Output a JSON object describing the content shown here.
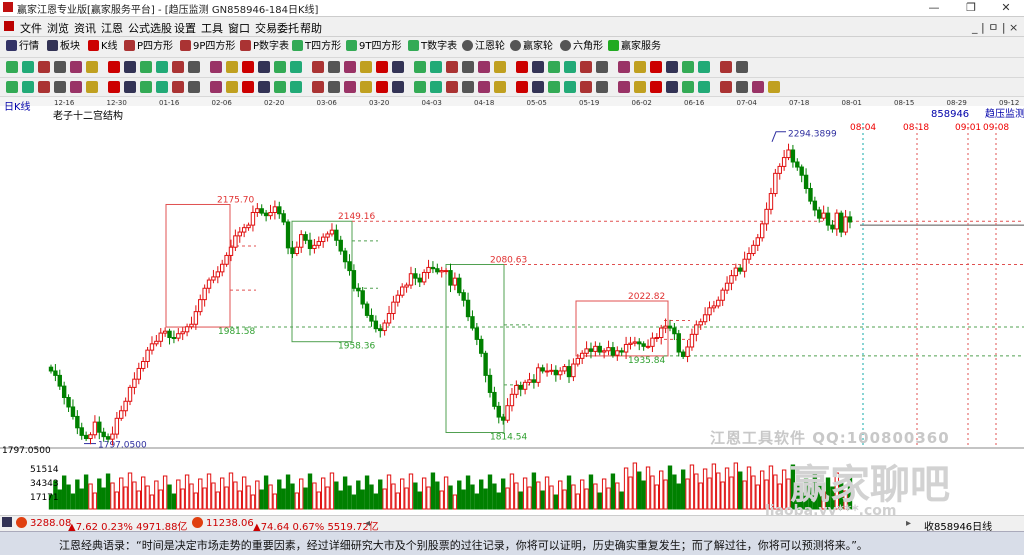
{
  "window": {
    "title": "赢家江恩专业版[赢家服务平台] - [趋压监测  GN858946-184日K线]",
    "buttons": {
      "min": "—",
      "max": "❐",
      "close": "✕"
    }
  },
  "menu": {
    "items": [
      "文件",
      "浏览",
      "资讯",
      "江恩",
      "公式选股",
      "设置",
      "工具",
      "窗口",
      "交易委托",
      "帮助"
    ],
    "right": "_ | ㅁ | ×"
  },
  "toolbar": {
    "items": [
      {
        "label": "行情",
        "icon": "grid-icon",
        "color": "#336"
      },
      {
        "label": "板块",
        "icon": "blocks-icon",
        "color": "#335"
      },
      {
        "label": "K线",
        "icon": "kline-icon",
        "color": "#c00"
      },
      {
        "label": "P四方形",
        "icon": "p-square-icon",
        "color": "#a33"
      },
      {
        "label": "9P四方形",
        "icon": "9p-square-icon",
        "color": "#a33"
      },
      {
        "label": "P数字表",
        "icon": "p-table-icon",
        "color": "#a33"
      },
      {
        "label": "T四方形",
        "icon": "t-square-icon",
        "color": "#3a5"
      },
      {
        "label": "9T四方形",
        "icon": "9t-square-icon",
        "color": "#3a5"
      },
      {
        "label": "T数字表",
        "icon": "t-table-icon",
        "color": "#3a5"
      },
      {
        "label": "江恩轮",
        "icon": "gann-wheel-icon",
        "color": "#555"
      },
      {
        "label": "赢家轮",
        "icon": "winner-wheel-icon",
        "color": "#555"
      },
      {
        "label": "六角形",
        "icon": "hexagon-icon",
        "color": "#555"
      },
      {
        "label": "赢家服务",
        "icon": "dollar-icon",
        "color": "#2a2"
      }
    ]
  },
  "chart_header": {
    "period": "日K线",
    "dates": [
      "12-16",
      "12-30",
      "01-16",
      "02-06",
      "02-20",
      "03-06",
      "03-20",
      "04-03",
      "04-18",
      "05-05",
      "05-19",
      "06-02",
      "06-16",
      "07-04",
      "07-18",
      "08-01",
      "08-15",
      "08-29",
      "09-12"
    ],
    "right_code": "858946",
    "right_label": "趋压监测",
    "study": "老子十二宫结构"
  },
  "chart_data": {
    "type": "candlestick",
    "price_labels": [
      {
        "text": "2294.3899",
        "value": 2294.39
      },
      {
        "text": "2175.70",
        "value": 2175.7
      },
      {
        "text": "2149.16",
        "value": 2149.16
      },
      {
        "text": "2080.63",
        "value": 2080.63
      },
      {
        "text": "2022.82",
        "value": 2022.82
      },
      {
        "text": "1981.58",
        "value": 1981.58
      },
      {
        "text": "1958.36",
        "value": 1958.36
      },
      {
        "text": "1935.84",
        "value": 1935.84
      },
      {
        "text": "1814.54",
        "value": 1814.54
      },
      {
        "text": "1797.0500",
        "value": 1797.05
      }
    ],
    "axis_price_label": "1797.0500",
    "future_dates": [
      "08-04",
      "08-18",
      "09-01",
      "09-08"
    ],
    "volume_axis": [
      "51514",
      "34343",
      "17171"
    ],
    "closes": [
      1912,
      1905,
      1888,
      1870,
      1855,
      1840,
      1822,
      1810,
      1805,
      1811,
      1831,
      1815,
      1808,
      1804,
      1812,
      1837,
      1849,
      1864,
      1886,
      1899,
      1916,
      1927,
      1945,
      1955,
      1959,
      1972,
      1975,
      1965,
      1964,
      1971,
      1974,
      1982,
      1986,
      2006,
      2025,
      2043,
      2056,
      2061,
      2069,
      2081,
      2095,
      2108,
      2126,
      2132,
      2139,
      2143,
      2163,
      2169,
      2162,
      2158,
      2163,
      2172,
      2161,
      2148,
      2107,
      2098,
      2108,
      2128,
      2119,
      2106,
      2111,
      2117,
      2124,
      2129,
      2135,
      2119,
      2102,
      2085,
      2071,
      2043,
      2039,
      2018,
      2000,
      1991,
      1979,
      1976,
      1988,
      2003,
      2021,
      2032,
      2045,
      2048,
      2066,
      2059,
      2053,
      2068,
      2076,
      2074,
      2069,
      2071,
      2071,
      2048,
      2059,
      2036,
      2024,
      1998,
      1980,
      1962,
      1940,
      1905,
      1878,
      1856,
      1839,
      1834,
      1857,
      1875,
      1889,
      1883,
      1894,
      1898,
      1894,
      1917,
      1912,
      1912,
      1913,
      1906,
      1912,
      1919,
      1903,
      1923,
      1932,
      1940,
      1947,
      1943,
      1951,
      1942,
      1944,
      1949,
      1937,
      1944,
      1942,
      1954,
      1956,
      1958,
      1955,
      1951,
      1951,
      1964,
      1965,
      1980,
      1983,
      1980,
      1971,
      1942,
      1935,
      1950,
      1970,
      1985,
      1990,
      2001,
      2012,
      2015,
      2024,
      2040,
      2051,
      2063,
      2075,
      2070,
      2089,
      2098,
      2111,
      2123,
      2145,
      2168,
      2193,
      2225,
      2236,
      2250,
      2262,
      2243,
      2235,
      2222,
      2201,
      2181,
      2167,
      2154,
      2162,
      2143,
      2137,
      2162,
      2132,
      2156,
      2148
    ]
  },
  "status": {
    "idx1": "3288.08",
    "idx1_change": "▲7.62 0.23% 4971.88亿",
    "idx2": "11238.06",
    "idx2_change": "▲74.64 0.67% 5519.72亿",
    "right": "收858946日线"
  },
  "watermark": {
    "line1": "江恩工具软件  QQ:100800360",
    "line2": "赢家聊吧",
    "line3": "liaoba.yy***.com"
  },
  "quote": "江恩经典语录：“时间是决定市场走势的重要因素，经过详细研究大市及个别股票的过往记录，你将可以证明，历史确实重复发生；而了解过往，你将可以预测将来。”。",
  "colors": {
    "up": "#e01010",
    "down": "#008000",
    "bg": "#ffffff"
  }
}
